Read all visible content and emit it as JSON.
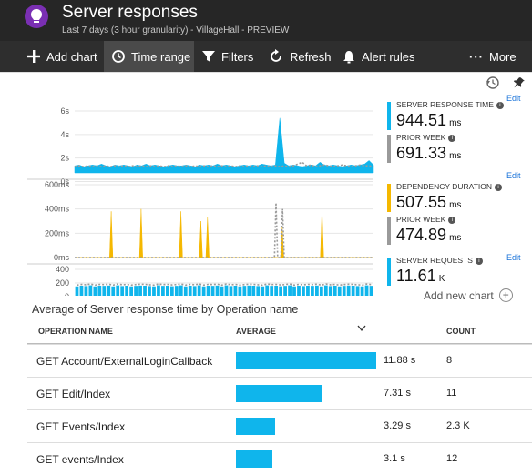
{
  "header": {
    "title": "Server responses",
    "subtitle": "Last 7 days (3 hour granularity) - VillageHall - PREVIEW"
  },
  "toolbar": {
    "add_chart": "Add chart",
    "time_range": "Time range",
    "filters": "Filters",
    "refresh": "Refresh",
    "alert_rules": "Alert rules",
    "more": "More"
  },
  "colors": {
    "accent": "#0fb5ec",
    "dependency": "#f5b800",
    "prior": "#9a9a9a",
    "link": "#1a73d9"
  },
  "chart_data": [
    {
      "type": "area",
      "title": "",
      "yticks": [
        "6s",
        "4s",
        "2s",
        "0s"
      ],
      "ylim": [
        0,
        7
      ],
      "series": [
        {
          "name": "SERVER RESPONSE TIME",
          "values": [
            0.8,
            0.9,
            0.7,
            0.8,
            0.9,
            0.8,
            1.0,
            0.8,
            0.7,
            0.9,
            0.8,
            0.9,
            0.8,
            0.7,
            0.9,
            0.8,
            1.0,
            0.8,
            0.9,
            0.8,
            0.7,
            0.8,
            0.9,
            0.8,
            0.8,
            0.9,
            0.8,
            0.7,
            0.9,
            0.8,
            0.9,
            0.8,
            1.0,
            0.8,
            0.9,
            0.8,
            0.7,
            0.8,
            0.9,
            0.8,
            0.9,
            0.8,
            1.0,
            0.9,
            0.8,
            0.9,
            6.2,
            1.1,
            0.8,
            0.9,
            0.8,
            0.7,
            0.8,
            0.9,
            0.8,
            1.2,
            0.9,
            0.8,
            0.9,
            0.8,
            0.7,
            0.8,
            0.9,
            0.8,
            0.9,
            1.0,
            1.4,
            0.9
          ]
        },
        {
          "name": "PRIOR WEEK",
          "values": [
            0.7,
            0.8,
            0.7,
            0.8,
            0.7,
            0.8,
            0.7,
            0.8,
            0.7,
            0.8,
            0.7,
            0.8,
            0.7,
            0.8,
            0.7,
            0.8,
            0.7,
            0.8,
            0.7,
            0.8,
            0.7,
            0.8,
            0.7,
            0.8,
            0.7,
            0.8,
            0.7,
            0.8,
            0.7,
            0.8,
            0.7,
            0.8,
            0.7,
            0.8,
            0.7,
            0.8,
            0.7,
            0.8,
            0.7,
            0.8,
            0.7,
            0.8,
            0.7,
            0.8,
            0.7,
            0.8,
            0.7,
            0.8,
            0.7,
            0.8,
            1.0,
            1.2,
            0.8,
            0.9,
            0.7,
            0.8,
            0.9,
            0.8,
            0.7,
            0.8,
            0.9,
            0.8,
            0.7,
            0.8,
            0.9,
            0.8,
            0.8,
            0.7
          ]
        }
      ]
    },
    {
      "type": "area",
      "title": "",
      "yticks": [
        "600ms",
        "400ms",
        "200ms",
        "0ms"
      ],
      "ylim": [
        0,
        600
      ],
      "series": [
        {
          "name": "DEPENDENCY DURATION",
          "values": [
            0,
            0,
            0,
            0,
            0,
            0,
            0,
            0,
            0,
            0,
            0,
            0,
            0,
            0,
            0,
            0,
            0,
            0,
            0,
            0,
            0,
            0,
            380,
            0,
            0,
            0,
            0,
            0,
            0,
            0,
            0,
            0,
            0,
            0,
            0,
            0,
            0,
            0,
            0,
            0,
            400,
            0,
            0,
            0,
            0,
            0,
            0,
            0,
            0,
            0,
            0,
            0,
            0,
            0,
            0,
            0,
            0,
            0,
            0,
            0,
            0,
            0,
            0,
            0,
            380,
            0,
            0,
            0,
            0,
            0,
            0,
            0,
            0,
            0,
            0,
            0,
            300,
            0,
            0,
            0,
            330,
            0,
            0,
            0,
            0,
            0,
            0,
            0,
            0,
            0,
            0,
            0,
            0,
            0,
            0,
            0,
            0,
            0,
            0,
            0,
            0,
            0,
            0,
            0,
            0,
            0,
            0,
            0,
            0,
            0,
            0,
            0,
            0,
            0,
            0,
            0,
            0,
            0,
            0,
            0,
            0,
            0,
            0,
            0,
            0,
            250,
            0,
            0,
            0,
            0,
            0,
            0,
            0,
            0,
            0,
            0,
            0,
            0,
            0,
            0,
            0,
            0,
            0,
            0,
            0,
            0,
            0,
            0,
            0,
            400,
            0,
            0,
            0,
            0,
            0,
            0,
            0,
            0,
            0,
            0,
            0,
            0,
            0,
            0,
            0,
            0,
            0,
            0,
            0,
            0,
            0,
            0,
            0,
            0,
            0,
            0,
            0,
            0,
            0,
            0,
            0
          ]
        },
        {
          "name": "PRIOR WEEK",
          "values": [
            0,
            0,
            0,
            0,
            0,
            0,
            0,
            0,
            0,
            0,
            0,
            0,
            0,
            0,
            0,
            0,
            0,
            0,
            0,
            0,
            0,
            0,
            0,
            0,
            0,
            0,
            0,
            0,
            0,
            0,
            0,
            0,
            0,
            0,
            0,
            0,
            0,
            0,
            0,
            0,
            0,
            0,
            0,
            0,
            0,
            0,
            0,
            0,
            0,
            0,
            0,
            0,
            0,
            0,
            0,
            0,
            0,
            0,
            0,
            0,
            0,
            0,
            0,
            0,
            0,
            0,
            0,
            0,
            0,
            0,
            0,
            0,
            0,
            0,
            0,
            0,
            0,
            0,
            0,
            0,
            0,
            0,
            0,
            0,
            0,
            0,
            0,
            0,
            0,
            0,
            0,
            0,
            0,
            0,
            0,
            0,
            0,
            0,
            0,
            0,
            0,
            0,
            0,
            0,
            0,
            0,
            0,
            0,
            0,
            0,
            0,
            0,
            0,
            0,
            0,
            0,
            0,
            0,
            0,
            0,
            0,
            0,
            0,
            0,
            450,
            0,
            0,
            0,
            400,
            0,
            0,
            0,
            0,
            0,
            0,
            0,
            0,
            0,
            0,
            0,
            0,
            0,
            0,
            0,
            0,
            0,
            0,
            0,
            0,
            0,
            0,
            0,
            0,
            0,
            0,
            0,
            0,
            0,
            0,
            0,
            0,
            0,
            0,
            0,
            0,
            0,
            0,
            0,
            0,
            0,
            0,
            0,
            0,
            0,
            0,
            0,
            0,
            0,
            0,
            0,
            0,
            0,
            0,
            0,
            0
          ]
        }
      ]
    },
    {
      "type": "bar",
      "title": "",
      "yticks": [
        "400",
        "200",
        "0"
      ],
      "ylim": [
        0,
        400
      ],
      "series": [
        {
          "name": "SERVER REQUESTS",
          "values": [
            150,
            160,
            155,
            165,
            150,
            160,
            158,
            162,
            150,
            165,
            155,
            160,
            150,
            158,
            162,
            160,
            155,
            150,
            165,
            158,
            160,
            152,
            158,
            165,
            150,
            160,
            155,
            165,
            150,
            160,
            158,
            162,
            150,
            165,
            155,
            160,
            150,
            158,
            162,
            160,
            155,
            150,
            165,
            158,
            160,
            152,
            158,
            165,
            150,
            160,
            155,
            160,
            158,
            162,
            150,
            165,
            155,
            160,
            150,
            158,
            162,
            160,
            155,
            150,
            165,
            158
          ]
        },
        {
          "name": "PRIOR WEEK",
          "values": [
            170,
            180,
            175,
            185,
            170,
            180,
            178,
            182,
            170,
            185,
            175,
            180,
            170,
            178,
            182,
            180,
            175,
            170,
            185,
            178,
            180,
            172,
            178,
            185,
            170,
            180,
            175,
            185,
            170,
            180,
            178,
            182,
            170,
            185,
            175,
            180,
            170,
            178,
            182,
            180,
            175,
            170,
            185,
            178,
            180,
            172,
            178,
            185,
            170,
            180,
            175,
            180,
            178,
            182,
            170,
            185,
            175,
            180,
            170,
            178,
            182,
            180,
            175,
            170,
            185,
            178
          ]
        }
      ]
    }
  ],
  "metrics": [
    {
      "label": "SERVER RESPONSE TIME",
      "value": "944.51",
      "unit": "ms",
      "color": "#0fb5ec"
    },
    {
      "label": "PRIOR WEEK",
      "value": "691.33",
      "unit": "ms",
      "color": "#9a9a9a"
    },
    {
      "label": "DEPENDENCY DURATION",
      "value": "507.55",
      "unit": "ms",
      "color": "#f5b800"
    },
    {
      "label": "PRIOR WEEK",
      "value": "474.89",
      "unit": "ms",
      "color": "#9a9a9a"
    },
    {
      "label": "SERVER REQUESTS",
      "value": "11.61",
      "unit": "K",
      "color": "#0fb5ec"
    }
  ],
  "edit_label": "Edit",
  "add_chart_label": "Add new chart",
  "table": {
    "title": "Average of Server response time by Operation name",
    "columns": [
      "OPERATION NAME",
      "AVERAGE",
      "COUNT"
    ],
    "rows": [
      {
        "name": "GET Account/ExternalLoginCallback",
        "average": "11.88 s",
        "count": "8",
        "fraction": 1.0
      },
      {
        "name": "GET Edit/Index",
        "average": "7.31 s",
        "count": "11",
        "fraction": 0.615
      },
      {
        "name": "GET Events/Index",
        "average": "3.29 s",
        "count": "2.3 K",
        "fraction": 0.277
      },
      {
        "name": "GET events/Index",
        "average": "3.1 s",
        "count": "12",
        "fraction": 0.261
      }
    ]
  }
}
